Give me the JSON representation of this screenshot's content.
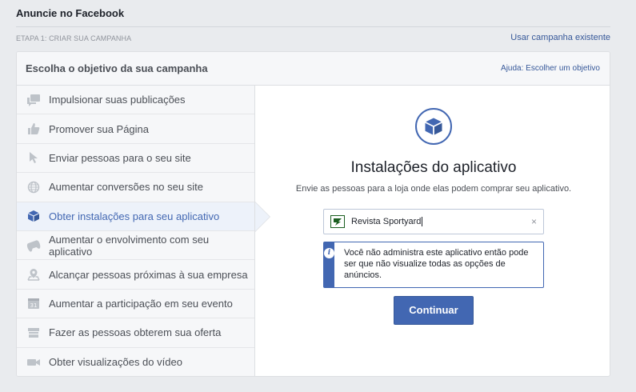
{
  "header": {
    "title": "Anuncie no Facebook",
    "step": "ETAPA 1: CRIAR SUA CAMPANHA",
    "use_existing": "Usar campanha existente"
  },
  "card": {
    "title": "Escolha o objetivo da sua campanha",
    "help_link": "Ajuda: Escolher um objetivo"
  },
  "objectives": [
    {
      "label": "Impulsionar suas publicações",
      "icon": "speech-bubbles-icon"
    },
    {
      "label": "Promover sua Página",
      "icon": "thumbs-up-icon"
    },
    {
      "label": "Enviar pessoas para o seu site",
      "icon": "cursor-icon"
    },
    {
      "label": "Aumentar conversões no seu site",
      "icon": "globe-icon"
    },
    {
      "label": "Obter instalações para seu aplicativo",
      "icon": "box-icon",
      "selected": true
    },
    {
      "label": "Aumentar o envolvimento com seu aplicativo",
      "icon": "gamepad-icon"
    },
    {
      "label": "Alcançar pessoas próximas à sua empresa",
      "icon": "location-pin-icon"
    },
    {
      "label": "Aumentar a participação em seu evento",
      "icon": "calendar-icon"
    },
    {
      "label": "Fazer as pessoas obterem sua oferta",
      "icon": "offer-tag-icon"
    },
    {
      "label": "Obter visualizações do vídeo",
      "icon": "video-camera-icon"
    }
  ],
  "detail": {
    "title": "Instalações do aplicativo",
    "description": "Envie as pessoas para a loja onde elas podem comprar seu aplicativo.",
    "app_value": "Revista Sportyard",
    "clear_symbol": "×",
    "info_icon": "i",
    "info_text": "Você não administra este aplicativo então pode ser que não visualize todas as opções de anúncios.",
    "continue_label": "Continuar"
  },
  "colors": {
    "accent": "#4267b2",
    "link": "#365899",
    "icon_gray": "#bec3c9",
    "selected_bg": "#edf2fa"
  }
}
